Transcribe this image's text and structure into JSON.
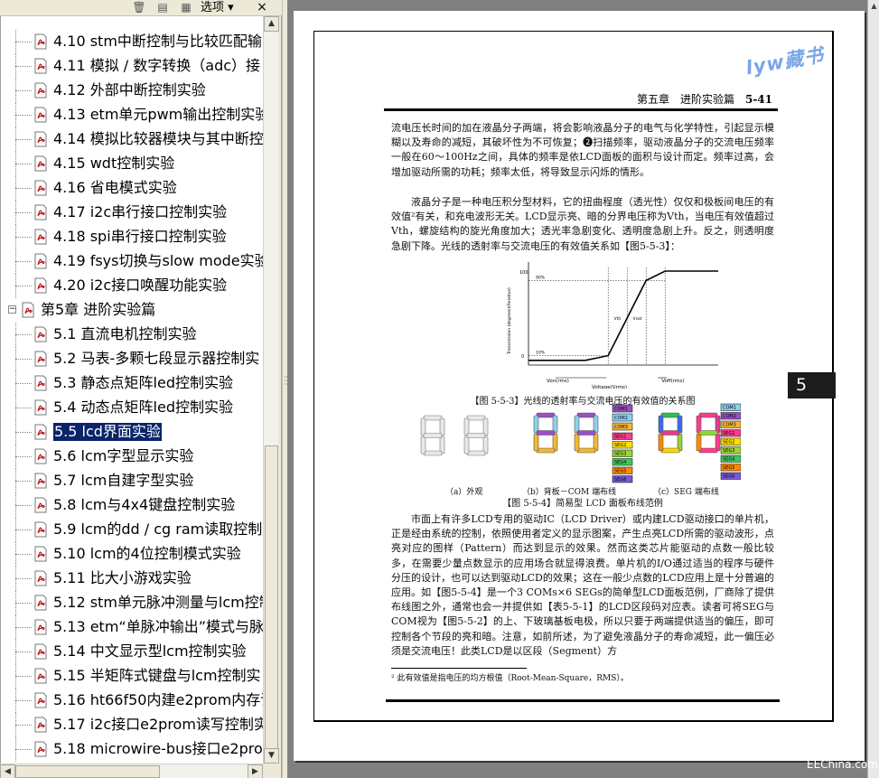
{
  "toolbar": {
    "options_label": "选项",
    "close_label": "×",
    "icons": [
      "trash-icon",
      "bookmark-expand-icon",
      "bookmark-properties-icon"
    ]
  },
  "bookmarks": [
    {
      "label": "4.10 stm中断控制与比较匹配输",
      "kind": "section"
    },
    {
      "label": "4.11 模拟 / 数字转换（adc）接",
      "kind": "section"
    },
    {
      "label": "4.12 外部中断控制实验",
      "kind": "section"
    },
    {
      "label": "4.13 etm单元pwm输出控制实验",
      "kind": "section"
    },
    {
      "label": "4.14 模拟比较器模块与其中断控",
      "kind": "section"
    },
    {
      "label": "4.15 wdt控制实验",
      "kind": "section"
    },
    {
      "label": "4.16 省电模式实验",
      "kind": "section"
    },
    {
      "label": "4.17 i2c串行接口控制实验",
      "kind": "section"
    },
    {
      "label": "4.18 spi串行接口控制实验",
      "kind": "section"
    },
    {
      "label": "4.19 fsys切换与slow mode实验",
      "kind": "section"
    },
    {
      "label": "4.20 i2c接口唤醒功能实验",
      "kind": "section"
    },
    {
      "label": "第5章 进阶实验篇",
      "kind": "chapter"
    },
    {
      "label": "5.1 直流电机控制实验",
      "kind": "section"
    },
    {
      "label": "5.2 马表-多颗七段显示器控制实",
      "kind": "section"
    },
    {
      "label": "5.3 静态点矩阵led控制实验",
      "kind": "section"
    },
    {
      "label": "5.4 动态点矩阵led控制实验",
      "kind": "section"
    },
    {
      "label": "5.5 lcd界面实验",
      "kind": "section",
      "selected": true
    },
    {
      "label": "5.6 lcm字型显示实验",
      "kind": "section"
    },
    {
      "label": "5.7 lcm自建字型实验",
      "kind": "section"
    },
    {
      "label": "5.8 lcm与4x4键盘控制实验",
      "kind": "section"
    },
    {
      "label": "5.9 lcm的dd / cg ram读取控制实",
      "kind": "section"
    },
    {
      "label": "5.10 lcm的4位控制模式实验",
      "kind": "section"
    },
    {
      "label": "5.11 比大小游戏实验",
      "kind": "section"
    },
    {
      "label": "5.12 stm单元脉冲测量与lcm控制",
      "kind": "section"
    },
    {
      "label": "5.13 etm“单脉冲输出”模式与脉",
      "kind": "section"
    },
    {
      "label": "5.14 中文显示型lcm控制实验",
      "kind": "section"
    },
    {
      "label": "5.15 半矩阵式键盘与lcm控制实",
      "kind": "section"
    },
    {
      "label": "5.16 ht66f50内建e2prom内存读",
      "kind": "section"
    },
    {
      "label": "5.17 i2c接口e2prom读写控制实",
      "kind": "section"
    },
    {
      "label": "5.18 microwire-bus接口e2prom",
      "kind": "section"
    }
  ],
  "page": {
    "watermark": "lyw藏书",
    "running_head_title": "第五章　进阶实验篇",
    "running_head_page": "5-41",
    "chapter_tab": "5",
    "para1": "流电压长时间的加在液晶分子两端，将会影响液晶分子的电气与化学特性，引起显示模糊以及寿命的减短，其破坏性为不可恢复；❷扫描频率，驱动液晶分子的交流电压频率一般在60～100Hz之间，具体的频率是依LCD面板的面积与设计而定。频率过高，会增加驱动所需的功耗；频率太低，将导致显示闪烁的情形。",
    "para2": "液晶分子是一种电压积分型材料，它的扭曲程度（透光性）仅仅和极板间电压的有效值²有关，和充电波形无关。LCD显示亮、暗的分界电压称为Vth，当电压有效值超过Vth，螺旋结构的旋光角度加大；透光率急剧变化、透明度急剧上升。反之，则透明度急剧下降。光线的透射率与交流电压的有效值关系如【图5-5-3】：",
    "fig3_caption": "【图 5-5-3】光线的透射率与交流电压的有效值的关系图",
    "fig4_sub_a": "（a）外观",
    "fig4_sub_b": "（b）背板－COM 端布线",
    "fig4_sub_c": "（c）SEG 端布线",
    "fig4_caption": "【图 5-5-4】简易型 LCD 面板布线范例",
    "para3": "市面上有许多LCD专用的驱动IC（LCD Driver）或内建LCD驱动接口的单片机，正是经由系统的控制，依照使用者定义的显示图案，产生点亮LCD所需的驱动波形，点亮对应的图样（Pattern）而达到显示的效果。然而这类芯片能驱动的点数一般比较多，在需要少量点数显示的应用场合就显得浪费。单片机的I/O通过适当的程序与硬件分压的设计，也可以达到驱动LCD的效果；这在一般少点数的LCD应用上是十分普遍的应用。如【图5-5-4】是一个3 COMs×6 SEGs的简单型LCD面板范例，厂商除了提供布线图之外，通常也会一并提供如【表5-5-1】的LCD区段码对应表。读者可将SEG与COM视为【图5-5-2】的上、下玻璃基板电极，所以只要于两端提供适当的偏压，即可控制各个节段的亮和暗。注意，如前所述，为了避免液晶分子的寿命减短，此一偏压必须是交流电压！此类LCD是以区段（Segment）方",
    "footnote": "² 此有效值是指电压的均方根值（Root-Mean-Square，RMS）。"
  },
  "chart_data": {
    "type": "line",
    "title": "",
    "xlabel": "Voltage(Vrms)",
    "ylabel": "Transmission (degrees)(Relative)",
    "y_ticks": [
      "100",
      "90%",
      "10%",
      "0"
    ],
    "x_markers": [
      "Von(rms)",
      "Voff(rms)"
    ],
    "annotations": [
      "Vth",
      "Vsat"
    ],
    "series": [
      {
        "x": [
          0,
          0.3,
          0.42,
          0.62,
          0.72,
          1.0
        ],
        "y": [
          5,
          5,
          10,
          90,
          100,
          100
        ]
      }
    ]
  },
  "fig4_labels": {
    "com": [
      "COM1",
      "COM2",
      "COM3"
    ],
    "seg_b": [
      "SEG1",
      "SEG2",
      "SEG3",
      "SEG4",
      "SEG5",
      "SEG6"
    ],
    "seg_c": [
      "COM1",
      "COM2",
      "COM3",
      "SEG1",
      "SEG2",
      "SEG3",
      "SEG4",
      "SEG5",
      "SEG6"
    ]
  },
  "site_mark": "EEChina.com",
  "colors": {
    "selection": "#0a246a",
    "chapter_tab": "#1c1c1c",
    "watermark": "#7aa6e8"
  }
}
